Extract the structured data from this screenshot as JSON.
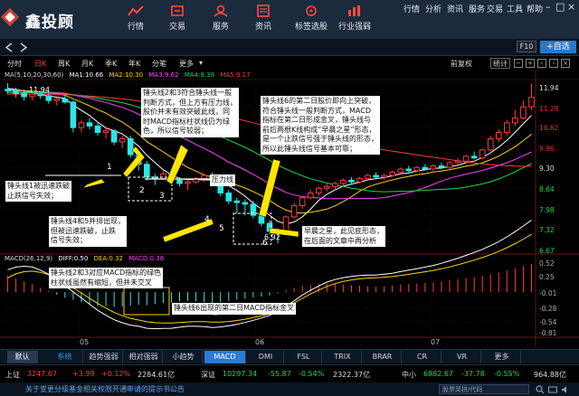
{
  "app": {
    "logo_text": "鑫投顾"
  },
  "nav": [
    {
      "label": "行情",
      "icon": "trend-icon"
    },
    {
      "label": "交易",
      "icon": "trade-icon"
    },
    {
      "label": "服务",
      "icon": "service-icon"
    },
    {
      "label": "资讯",
      "icon": "news-icon"
    },
    {
      "label": "标签选股",
      "icon": "tag-icon"
    },
    {
      "label": "行业强弱",
      "icon": "industry-icon"
    }
  ],
  "toplinks": [
    "行情",
    "分析",
    "资讯",
    "服务",
    "交易",
    "工具",
    "帮助"
  ],
  "subbar": {
    "f10": "F10",
    "add": "+自选"
  },
  "periods": [
    "分时",
    "日K",
    "周K",
    "月K",
    "季K",
    "年K",
    "分笔",
    "更多"
  ],
  "right_controls": {
    "fq": "前复权",
    "tongji": "统计"
  },
  "ma_legend": {
    "prefix": "MA(5,10,20,30,60)",
    "ma1": "MA1:10.66",
    "ma2": "MA2:10.30",
    "ma3": "MA3:9.62",
    "ma4": "MA4:9.39",
    "ma5": "MA5:9.17"
  },
  "macd_legend": {
    "prefix": "MACD(26,12,9)",
    "diff": "DIFF:0.50",
    "dea": "DEA:0.32",
    "macd": "MACD:0.38"
  },
  "price_labels": {
    "top": "11.94",
    "low": "6.92",
    "y_axis": [
      "11.94",
      "11.28",
      "10.62",
      "9.96",
      "9.30",
      "8.64",
      "7.98",
      "7.32",
      "6.67"
    ],
    "macd_axis": [
      "0.52",
      "0.25",
      "-0.01",
      "-0.28",
      "-0.54",
      "-0.81"
    ],
    "x_axis": [
      "05",
      "06",
      "07"
    ]
  },
  "annotations": {
    "a1": [
      "锤头线2和3符合锤头线一般",
      "判断方式，但上方有压力线，",
      "股价并未有效突破此线，同",
      "时MACD指标柱状线仍为绿",
      "色，所以信号较弱；"
    ],
    "a2": [
      "锤头线6的第二日股价即向上突破，",
      "符合锤头线一般判断方式，MACD",
      "指标在第二日形成金叉，锤头线与",
      "前后两根K线构成“早晨之星”形态，",
      "是一个止跌信号强于锤头线的形态，",
      "所以此锤头线信号基本可靠；"
    ],
    "a3": [
      "锤头线1被迅速跌破",
      "止跌信号失效；"
    ],
    "a4": [
      "锤头线4和5并排出现，",
      "但被迅速跌破，止跌",
      "信号失效；"
    ],
    "a5": [
      "早晨之星，此见底形态，",
      "在后面的文章中再分析"
    ],
    "a6": [
      "锤头线2和3对应MACD指标的绿色",
      "柱状线虽然有缩短，但并未交叉"
    ],
    "a7": "锤头线6出现的第二日MACD指标金叉",
    "pressure": "压力线",
    "nums": [
      "1",
      "2",
      "3",
      "4",
      "5",
      "6"
    ]
  },
  "toolbar": {
    "default": "默认",
    "system": "系统",
    "tabs": [
      "趋势强弱",
      "相对强弱",
      "小趋势",
      "MACD",
      "DMI",
      "FSL",
      "TRIX",
      "BRAR",
      "CR",
      "VR",
      "更多"
    ]
  },
  "status": {
    "sh_label": "上证",
    "sh_val": "3247.67",
    "sh_chg": "+3.99",
    "sh_pct": "+0.12%",
    "sh_amt": "2284.61亿",
    "sz_label": "深证",
    "sz_val": "10297.34",
    "sz_chg": "-55.87",
    "sz_pct": "-0.54%",
    "sz_amt": "2322.37亿",
    "zx_label": "中小",
    "zx_val": "6882.67",
    "zx_chg": "-37.78",
    "zx_pct": "-0.55%",
    "zx_amt": "964.88亿"
  },
  "footer": {
    "notice": "关于变更分级基金相关权限开通申请的提示书公告",
    "search": "股票简拼/代码"
  },
  "colors": {
    "up": "#ff3a3a",
    "down": "#19d94a",
    "ma1": "#ffffff",
    "ma2": "#ffd200",
    "ma3": "#ff40ff",
    "ma4": "#19d94a",
    "ma5": "#ff3a3a"
  },
  "chart_data": {
    "type": "candlestick",
    "candles": [
      [
        11.75,
        11.94,
        11.6,
        11.7
      ],
      [
        11.7,
        11.8,
        11.5,
        11.62
      ],
      [
        11.62,
        11.75,
        11.4,
        11.52
      ],
      [
        11.52,
        11.68,
        11.4,
        11.6
      ],
      [
        11.6,
        11.7,
        11.45,
        11.55
      ],
      [
        11.55,
        11.65,
        11.3,
        11.4
      ],
      [
        11.4,
        11.5,
        11.25,
        11.45
      ],
      [
        11.45,
        11.55,
        11.3,
        11.35
      ],
      [
        11.35,
        11.4,
        10.4,
        10.55
      ],
      [
        10.55,
        10.8,
        10.4,
        10.7
      ],
      [
        10.7,
        10.85,
        10.5,
        10.6
      ],
      [
        10.6,
        10.7,
        10.3,
        10.4
      ],
      [
        10.4,
        10.55,
        10.2,
        10.45
      ],
      [
        10.45,
        10.5,
        10.0,
        10.1
      ],
      [
        10.1,
        10.3,
        9.9,
        10.2
      ],
      [
        10.2,
        10.3,
        9.6,
        9.7
      ],
      [
        9.7,
        9.8,
        9.2,
        9.4
      ],
      [
        9.4,
        9.5,
        8.9,
        9.0
      ],
      [
        9.0,
        9.1,
        8.75,
        8.95
      ],
      [
        8.95,
        9.2,
        8.9,
        9.1
      ],
      [
        9.1,
        9.25,
        8.85,
        8.9
      ],
      [
        8.9,
        9.0,
        8.7,
        8.8
      ],
      [
        8.8,
        8.95,
        8.6,
        8.85
      ],
      [
        8.85,
        9.0,
        8.8,
        8.95
      ],
      [
        8.95,
        9.1,
        8.85,
        9.05
      ],
      [
        9.05,
        9.15,
        8.85,
        8.9
      ],
      [
        8.9,
        8.95,
        8.4,
        8.5
      ],
      [
        8.5,
        8.6,
        8.15,
        8.25
      ],
      [
        8.25,
        8.35,
        7.85,
        8.2
      ],
      [
        8.2,
        8.3,
        7.8,
        8.15
      ],
      [
        8.15,
        8.25,
        7.7,
        7.8
      ],
      [
        7.8,
        7.9,
        7.45,
        7.55
      ],
      [
        7.55,
        7.65,
        7.2,
        7.3
      ],
      [
        7.3,
        7.4,
        6.92,
        7.25
      ],
      [
        7.25,
        7.8,
        7.2,
        7.75
      ],
      [
        7.75,
        8.2,
        7.7,
        8.1
      ],
      [
        8.1,
        8.4,
        8.0,
        8.35
      ],
      [
        8.35,
        8.6,
        8.3,
        8.5
      ],
      [
        8.5,
        8.7,
        8.4,
        8.65
      ],
      [
        8.65,
        8.8,
        8.55,
        8.7
      ],
      [
        8.7,
        8.85,
        8.6,
        8.8
      ],
      [
        8.8,
        8.95,
        8.7,
        8.9
      ],
      [
        8.9,
        9.0,
        8.75,
        8.85
      ],
      [
        8.85,
        9.0,
        8.8,
        8.95
      ],
      [
        8.95,
        9.1,
        8.9,
        9.05
      ],
      [
        9.05,
        9.15,
        8.95,
        9.0
      ],
      [
        9.0,
        9.1,
        8.9,
        9.05
      ],
      [
        9.05,
        9.2,
        9.0,
        9.15
      ],
      [
        9.15,
        9.3,
        9.1,
        9.25
      ],
      [
        9.25,
        9.35,
        9.15,
        9.2
      ],
      [
        9.2,
        9.35,
        9.15,
        9.3
      ],
      [
        9.3,
        9.4,
        9.2,
        9.25
      ],
      [
        9.25,
        9.4,
        9.2,
        9.35
      ],
      [
        9.35,
        9.45,
        9.25,
        9.3
      ],
      [
        9.3,
        9.5,
        9.25,
        9.45
      ],
      [
        9.45,
        9.6,
        9.4,
        9.5
      ],
      [
        9.5,
        9.7,
        9.45,
        9.65
      ],
      [
        9.65,
        9.8,
        9.55,
        9.6
      ],
      [
        9.6,
        9.9,
        9.55,
        9.85
      ],
      [
        9.85,
        10.3,
        9.8,
        10.2
      ],
      [
        10.2,
        10.5,
        10.1,
        10.4
      ],
      [
        10.4,
        10.8,
        10.3,
        10.7
      ],
      [
        10.7,
        11.1,
        10.6,
        10.85
      ],
      [
        10.85,
        11.4,
        10.8,
        11.2
      ],
      [
        11.2,
        11.94,
        11.1,
        11.5
      ]
    ],
    "ylim": [
      6.67,
      12.0
    ],
    "macd": {
      "bars": [
        0.3,
        0.25,
        0.2,
        0.15,
        0.08,
        0.02,
        -0.05,
        -0.1,
        -0.14,
        -0.18,
        -0.22,
        -0.25,
        -0.26,
        -0.27,
        -0.26,
        -0.25,
        -0.23,
        -0.24,
        -0.22,
        -0.2,
        -0.19,
        -0.17,
        -0.16,
        -0.17,
        -0.18,
        -0.2,
        -0.18,
        -0.16,
        -0.14,
        -0.12,
        -0.1,
        -0.08,
        -0.06,
        -0.02,
        0.04,
        0.08,
        0.12,
        0.14,
        0.15,
        0.16,
        0.15,
        0.14,
        0.13,
        0.12,
        0.11,
        0.1,
        0.11,
        0.12,
        0.14,
        0.15,
        0.16,
        0.17,
        0.18,
        0.2,
        0.22,
        0.24,
        0.26,
        0.28,
        0.3,
        0.33,
        0.36,
        0.4,
        0.44,
        0.48,
        0.52
      ],
      "ylim": [
        -0.81,
        0.6
      ]
    }
  }
}
